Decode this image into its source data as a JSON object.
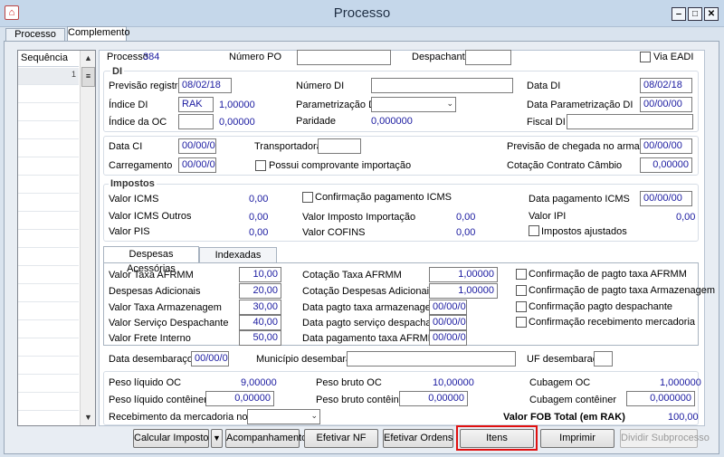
{
  "window": {
    "title": "Processo"
  },
  "tabs": [
    "Processo",
    "Complemento"
  ],
  "grid": {
    "header": "Sequência",
    "row1": "1"
  },
  "top": {
    "processo_label": "Processo",
    "processo_val": "384",
    "numero_po_label": "Número PO",
    "despachante_label": "Despachante",
    "via_eadi_label": "Via EADI"
  },
  "di": {
    "title": "DI",
    "previsao_registro_label": "Previsão registro",
    "previsao_registro_val": "08/02/18",
    "numero_di_label": "Número DI",
    "data_di_label": "Data DI",
    "data_di_val": "08/02/18",
    "indice_di_label": "Índice DI",
    "indice_di_val": "RAK",
    "indice_di_rate": "1,00000",
    "parametrizacao_di_label": "Parametrização DI",
    "data_param_label": "Data Parametrização DI",
    "data_param_val": "00/00/00",
    "indice_oc_label": "Índice da OC",
    "indice_oc_rate": "0,00000",
    "paridade_label": "Paridade",
    "paridade_val": "0,000000",
    "fiscal_di_label": "Fiscal DI"
  },
  "mid": {
    "data_ci_label": "Data CI",
    "data_ci_val": "00/00/00",
    "transportadora_label": "Transportadora",
    "previsao_chegada_label": "Previsão de chegada no armazém",
    "previsao_chegada_val": "00/00/00",
    "carregamento_label": "Carregamento",
    "carregamento_val": "00/00/00",
    "possui_comprovante_label": "Possui comprovante importação",
    "cotacao_contrato_label": "Cotação Contrato Câmbio",
    "cotacao_contrato_val": "0,00000"
  },
  "impostos": {
    "title": "Impostos",
    "icms_label": "Valor ICMS",
    "icms_val": "0,00",
    "confirm_icms_label": "Confirmação pagamento ICMS",
    "data_pag_icms_label": "Data pagamento ICMS",
    "data_pag_icms_val": "00/00/00",
    "icms_outros_label": "Valor ICMS Outros",
    "icms_outros_val": "0,00",
    "imposto_import_label": "Valor Imposto Importação",
    "imposto_import_val": "0,00",
    "ipi_label": "Valor IPI",
    "ipi_val": "0,00",
    "pis_label": "Valor PIS",
    "pis_val": "0,00",
    "cofins_label": "Valor COFINS",
    "cofins_val": "0,00",
    "impostos_ajustados_label": "Impostos ajustados"
  },
  "subtabs": [
    "Despesas Acessórias",
    "Indexadas"
  ],
  "despesas": {
    "taxa_afrmm_label": "Valor Taxa AFRMM",
    "taxa_afrmm_val": "10,00",
    "adicionais_label": "Despesas Adicionais",
    "adicionais_val": "20,00",
    "taxa_armazenagem_label": "Valor Taxa Armazenagem",
    "taxa_armazenagem_val": "30,00",
    "servico_despachante_label": "Valor Serviço Despachante",
    "servico_despachante_val": "40,00",
    "frete_interno_label": "Valor Frete Interno",
    "frete_interno_val": "50,00",
    "cot_taxa_afrmm_label": "Cotação Taxa AFRMM",
    "cot_taxa_afrmm_val": "1,00000",
    "cot_desp_adic_label": "Cotação Despesas Adicionais",
    "cot_desp_adic_val": "1,00000",
    "data_pag_armaz_label": "Data pagto taxa armazenagem",
    "data_pag_armaz_val": "00/00/00",
    "data_pag_desp_label": "Data pagto serviço despachante",
    "data_pag_desp_val": "00/00/00",
    "data_pag_afrmm_label": "Data pagamento taxa AFRMM",
    "data_pag_afrmm_val": "00/00/00",
    "conf_afrmm_label": "Confirmação de pagto taxa AFRMM",
    "conf_armaz_label": "Confirmação de pagto taxa Armazenagem",
    "conf_desp_label": "Confirmação pagto despachante",
    "conf_receb_label": "Confirmação recebimento mercadoria"
  },
  "desemb": {
    "data_label": "Data desembaraço",
    "data_val": "00/00/00",
    "municipio_label": "Município desembaraço",
    "uf_label": "UF desembaraço"
  },
  "totais": {
    "peso_liq_oc_label": "Peso líquido OC",
    "peso_liq_oc_val": "9,00000",
    "peso_bruto_oc_label": "Peso bruto OC",
    "peso_bruto_oc_val": "10,00000",
    "cubagem_oc_label": "Cubagem OC",
    "cubagem_oc_val": "1,000000",
    "peso_liq_cont_label": "Peso líquido contêiner",
    "peso_liq_cont_val": "0,00000",
    "peso_bruto_cont_label": "Peso bruto contêiner",
    "peso_bruto_cont_val": "0,00000",
    "cubagem_cont_label": "Cubagem contêiner",
    "cubagem_cont_val": "0,000000",
    "recebimento_label": "Recebimento da mercadoria no CD",
    "fob_total_label": "Valor FOB Total (em RAK)",
    "fob_total_val": "100,00"
  },
  "buttons": {
    "calcular_imposto": "Calcular Imposto",
    "acompanhamento": "Acompanhamento",
    "efetivar_nf": "Efetivar NF",
    "efetivar_ordens": "Efetivar Ordens",
    "itens": "Itens",
    "imprimir": "Imprimir",
    "dividir_subprocesso": "Dividir Subprocesso"
  },
  "colors": {
    "value_text": "#1a1aa0",
    "highlight": "#e01010",
    "titlebar": "#c5d7ea"
  }
}
